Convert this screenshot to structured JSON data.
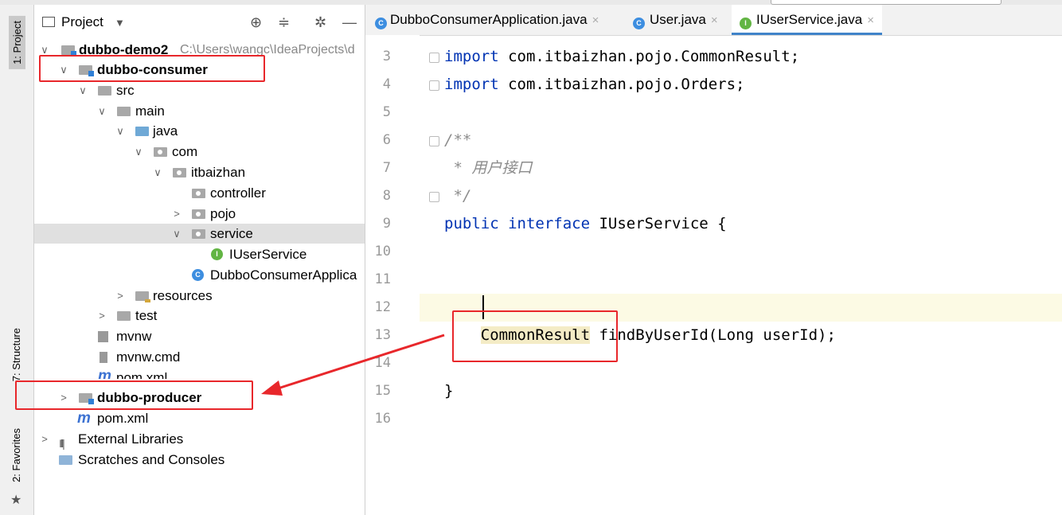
{
  "panel": {
    "title": "Project",
    "icons": [
      "crosshair-icon",
      "collapse-icon",
      "gear-icon",
      "minimize-icon"
    ]
  },
  "side_tabs": [
    "1: Project",
    "7: Structure",
    "2: Favorites"
  ],
  "tree": {
    "project": "dubbo-demo2",
    "project_path": "C:\\Users\\wangc\\IdeaProjects\\d",
    "consumer": "dubbo-consumer",
    "src": "src",
    "main": "main",
    "java": "java",
    "com": "com",
    "itbaizhan": "itbaizhan",
    "controller": "controller",
    "pojo": "pojo",
    "service": "service",
    "iuserservice": "IUserService",
    "app": "DubboConsumerApplica",
    "resources": "resources",
    "test": "test",
    "mvnw": "mvnw",
    "mvnw_cmd": "mvnw.cmd",
    "pom_inner": "pom.xml",
    "producer": "dubbo-producer",
    "pom_root": "pom.xml",
    "external": "External Libraries",
    "scratches": "Scratches and Consoles"
  },
  "tabs": [
    {
      "label": "DubboConsumerApplication.java",
      "close": "×"
    },
    {
      "label": "User.java",
      "close": "×"
    },
    {
      "label": "IUserService.java",
      "close": "×"
    }
  ],
  "badges": {
    "interface": "I",
    "class": "C",
    "maven": "m"
  },
  "lines": [
    "3",
    "4",
    "5",
    "6",
    "7",
    "8",
    "9",
    "10",
    "11",
    "12",
    "13",
    "14",
    "15",
    "16"
  ],
  "code": {
    "l3_kw": "import",
    "l3_rest": " com.itbaizhan.pojo.CommonResult;",
    "l4_kw": "import",
    "l4_rest": " com.itbaizhan.pojo.Orders;",
    "l6": "/**",
    "l7": " * 用户接口",
    "l8": " */",
    "l9_kw1": "public",
    "l9_kw2": " interface",
    "l9_rest": " IUserService {",
    "l13_indent": "    ",
    "l13_type": "CommonResult",
    "l13_rest": " findByUserId(Long userId);",
    "l15": "}"
  },
  "colors": {
    "annotation": "#e8272b",
    "keyword": "#0033b3",
    "tab_underline": "#4083c9"
  }
}
